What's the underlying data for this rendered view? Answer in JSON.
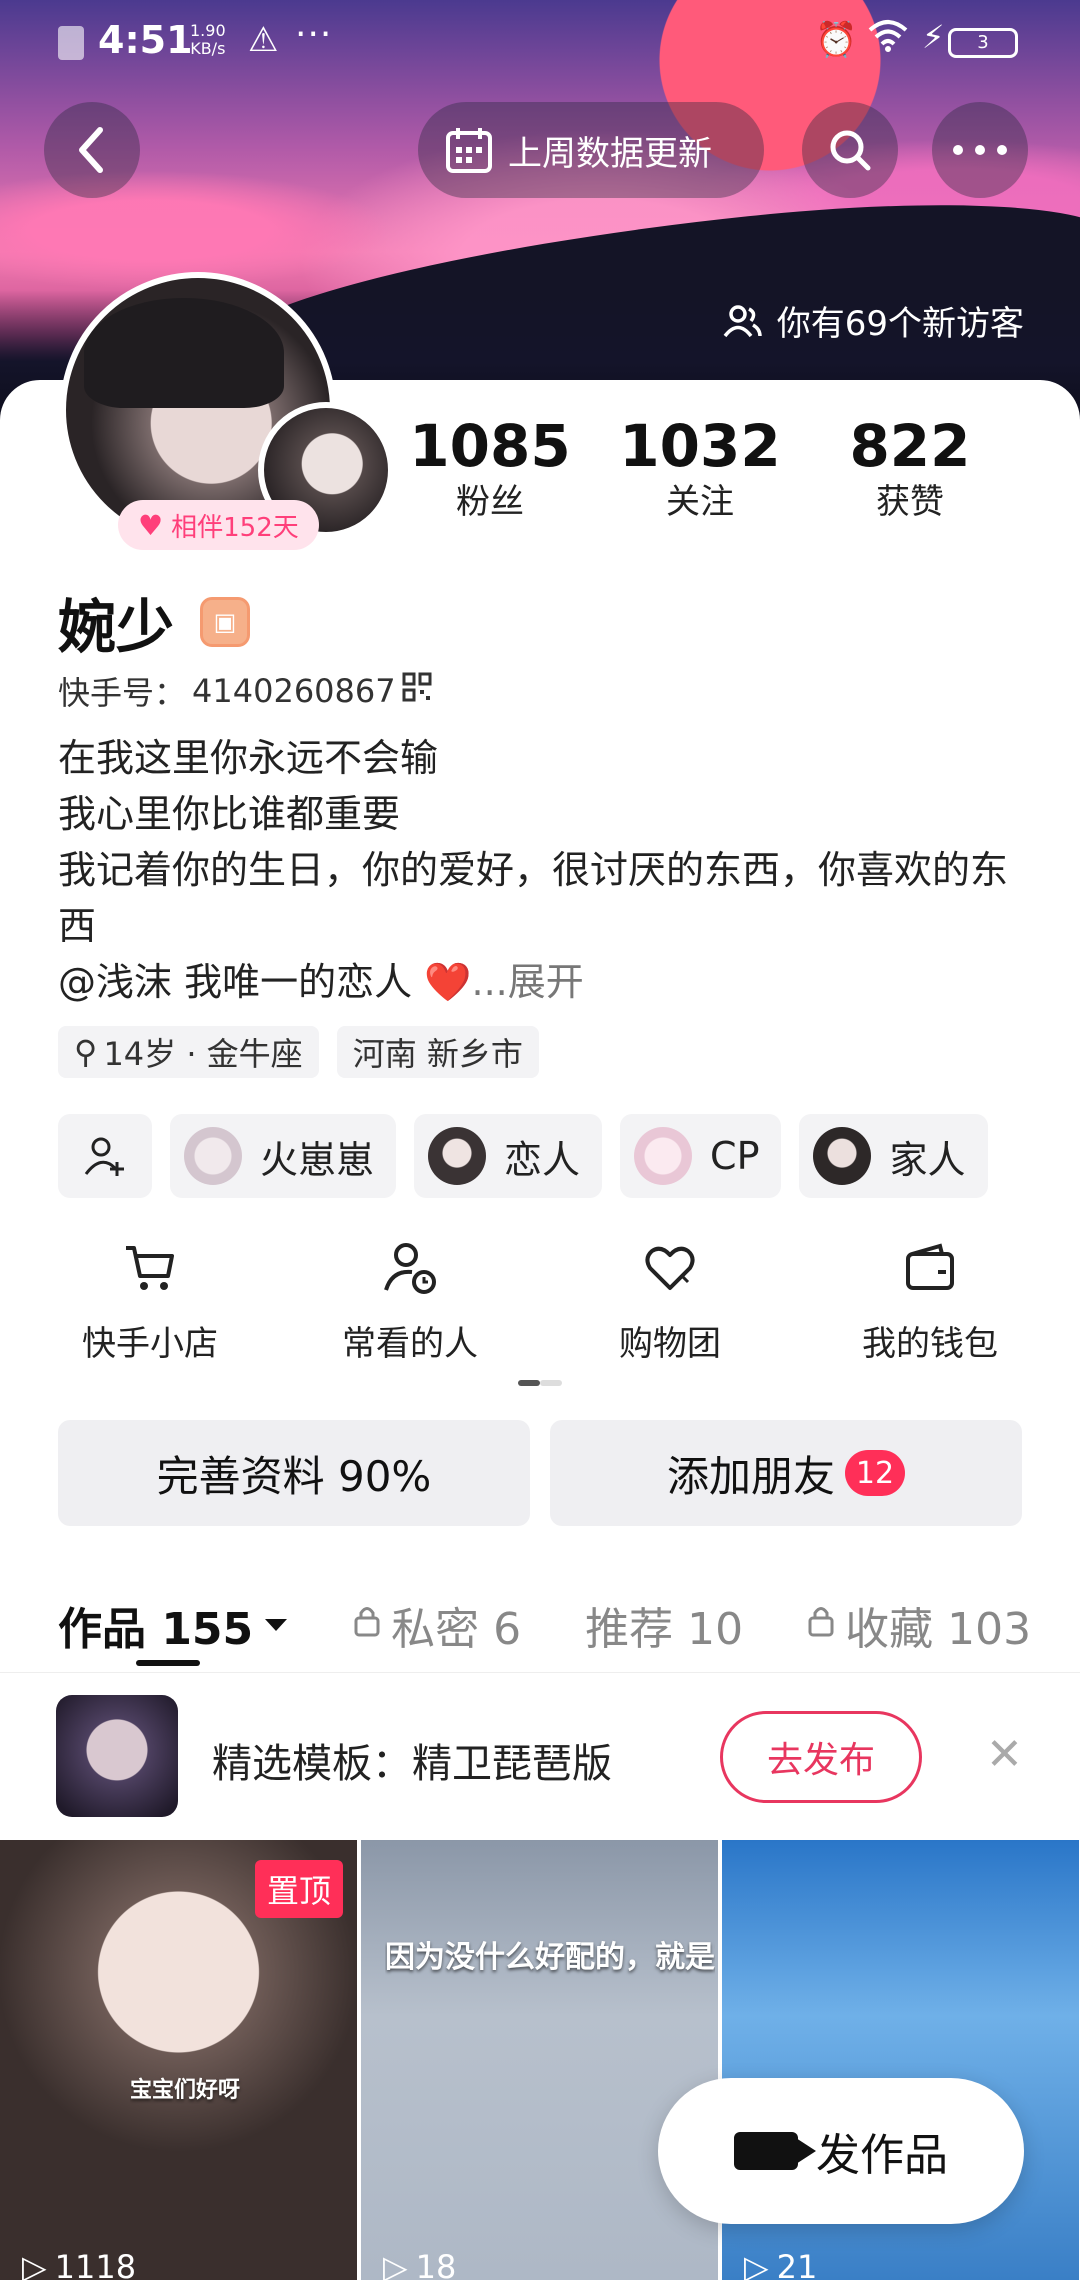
{
  "status_bar": {
    "time": "4:51",
    "speed_value": "1.90",
    "speed_unit": "KB/s",
    "battery": "3"
  },
  "header": {
    "data_update_label": "上周数据更新",
    "visitors_label": "你有69个新访客"
  },
  "profile": {
    "companion_badge": "相伴152天",
    "name": "婉少",
    "kuaishou_id_label": "快手号：",
    "kuaishou_id": "4140260867",
    "bio_lines": [
      "在我这里你永远不会输",
      "我心里你比谁都重要",
      "我记着你的生日，你的爱好，很讨厌的东西，你喜欢的东西"
    ],
    "bio_mention": "@浅沫 我唯一的恋人",
    "bio_heart": "❤️",
    "bio_expand": "...展开",
    "tags": [
      "14岁 · 金牛座",
      "河南 新乡市"
    ]
  },
  "stats": [
    {
      "num": "1085",
      "label": "粉丝"
    },
    {
      "num": "1032",
      "label": "关注"
    },
    {
      "num": "822",
      "label": "获赞"
    }
  ],
  "friends": [
    "火崽崽",
    "恋人",
    "CP",
    "家人"
  ],
  "shortcuts": [
    "快手小店",
    "常看的人",
    "购物团",
    "我的钱包"
  ],
  "actions": {
    "complete_profile": "完善资料 90%",
    "add_friends": "添加朋友",
    "add_friends_count": "12"
  },
  "tabs": {
    "works": "作品 155",
    "private": "私密 6",
    "recommend": "推荐 10",
    "favorites": "收藏 103"
  },
  "template_banner": {
    "text": "精选模板：精卫琵琶版",
    "button": "去发布"
  },
  "videos": [
    {
      "pinned": "置顶",
      "caption": "宝宝们好呀",
      "plays": "1118"
    },
    {
      "caption": "因为没什么好配的，就是正",
      "plays": "18"
    },
    {
      "caption": "",
      "plays": "21"
    }
  ],
  "fab_label": "发作品",
  "colors": {
    "accent": "#ff2f58",
    "publish_outline": "#e8365f",
    "companion_pink": "#ff3f7a"
  }
}
